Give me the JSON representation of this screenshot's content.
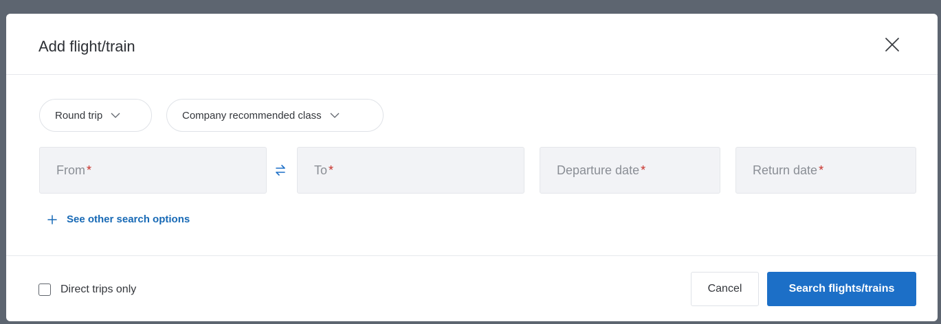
{
  "dialog": {
    "title": "Add flight/train",
    "close_icon": "close-icon"
  },
  "filters": {
    "trip_type": "Round trip",
    "cabin_class": "Company recommended class"
  },
  "fields": {
    "from_placeholder": "From",
    "to_placeholder": "To",
    "departure_placeholder": "Departure date",
    "return_placeholder": "Return date",
    "required_marker": "*"
  },
  "swap_icon": "swap-arrows-icon",
  "other_options_label": "See other search options",
  "footer": {
    "direct_only_label": "Direct trips only",
    "direct_only_checked": false,
    "cancel_label": "Cancel",
    "search_label": "Search flights/trains"
  },
  "colors": {
    "accent": "#1c6fc7",
    "link": "#1769b5",
    "required": "#c8322b",
    "field_bg": "#f2f3f6"
  }
}
